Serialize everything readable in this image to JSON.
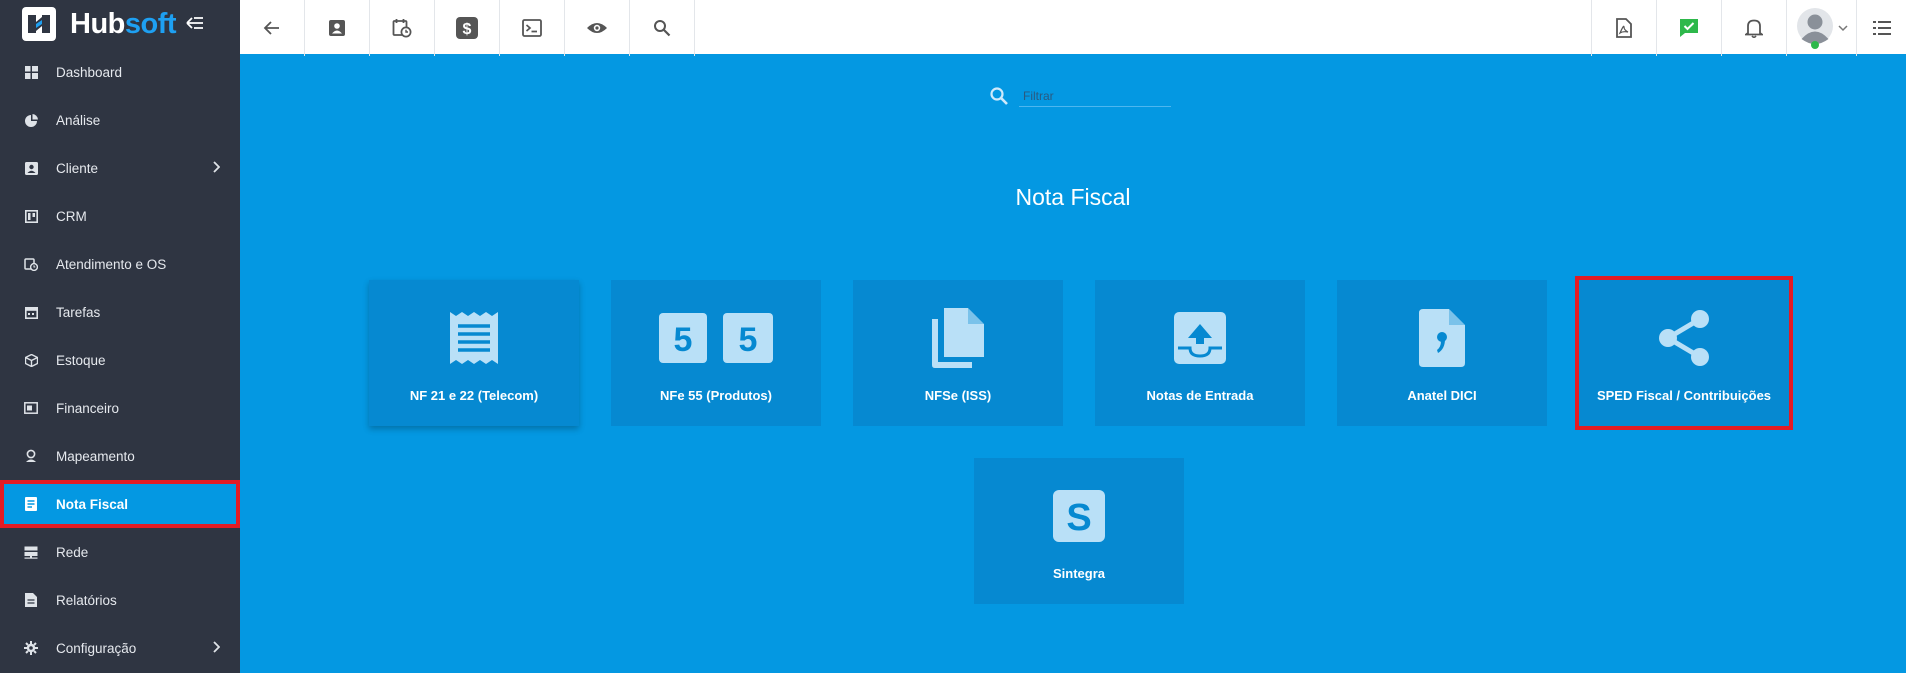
{
  "app": {
    "brand_part1": "Hub",
    "brand_part2": "soft"
  },
  "colors": {
    "accent": "#0498e2",
    "sidebar_bg": "#2f3542",
    "card_bg": "#0689d1",
    "highlight": "#e31b23",
    "brand_blue": "#1ea0f2"
  },
  "sidebar": {
    "items": [
      {
        "label": "Dashboard",
        "icon": "dashboard-icon"
      },
      {
        "label": "Análise",
        "icon": "pie-chart-icon"
      },
      {
        "label": "Cliente",
        "icon": "contact-card-icon",
        "has_submenu": true
      },
      {
        "label": "CRM",
        "icon": "board-icon"
      },
      {
        "label": "Atendimento e OS",
        "icon": "calendar-clock-icon"
      },
      {
        "label": "Tarefas",
        "icon": "calendar-icon"
      },
      {
        "label": "Estoque",
        "icon": "box-icon"
      },
      {
        "label": "Financeiro",
        "icon": "money-icon"
      },
      {
        "label": "Mapeamento",
        "icon": "map-pin-icon"
      },
      {
        "label": "Nota Fiscal",
        "icon": "document-icon",
        "active": true
      },
      {
        "label": "Rede",
        "icon": "server-icon"
      },
      {
        "label": "Relatórios",
        "icon": "report-icon"
      },
      {
        "label": "Configuração",
        "icon": "gear-icon",
        "has_submenu": true
      }
    ]
  },
  "topbar": {
    "left_icons": [
      "back-arrow-icon",
      "contact-card-icon",
      "calendar-clock-icon",
      "dollar-icon",
      "terminal-icon",
      "eye-icon",
      "search-icon"
    ],
    "right_icons": [
      "pdf-icon",
      "chat-check-icon",
      "bell-icon",
      "avatar",
      "menu-list-icon"
    ]
  },
  "main": {
    "search_placeholder": "Filtrar",
    "title": "Nota Fiscal",
    "cards": [
      {
        "label": "NF 21 e 22 (Telecom)",
        "icon": "receipt-icon"
      },
      {
        "label": "NFe 55 (Produtos)",
        "icon": "number-55-icon"
      },
      {
        "label": "NFSe (ISS)",
        "icon": "documents-icon"
      },
      {
        "label": "Notas de Entrada",
        "icon": "inbox-upload-icon"
      },
      {
        "label": "Anatel DICI",
        "icon": "file-comma-icon"
      },
      {
        "label": "SPED Fiscal / Contribuições",
        "icon": "share-icon",
        "highlighted": true
      },
      {
        "label": "Sintegra",
        "icon": "letter-s-icon"
      }
    ]
  }
}
